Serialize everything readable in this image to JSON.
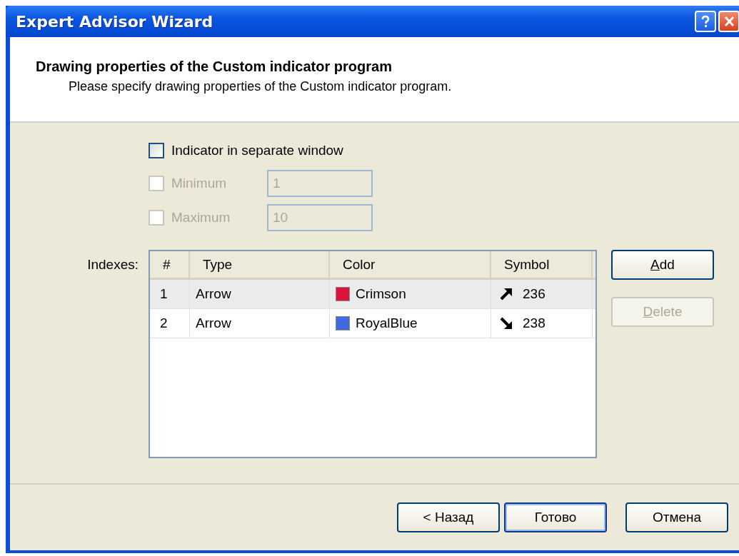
{
  "window": {
    "title": "Expert Advisor Wizard"
  },
  "header": {
    "title": "Drawing properties of the Custom indicator program",
    "subtitle": "Please specify drawing properties of the Custom indicator program."
  },
  "separate_window": {
    "label": "Indicator in separate window",
    "checked": false,
    "disabled": false
  },
  "limits": [
    {
      "label": "Minimum",
      "checked": false,
      "disabled": true,
      "value": "1"
    },
    {
      "label": "Maximum",
      "checked": false,
      "disabled": true,
      "value": "10"
    }
  ],
  "indexes": {
    "label": "Indexes:",
    "columns": [
      "#",
      "Type",
      "Color",
      "Symbol"
    ],
    "rows": [
      {
        "index": "1",
        "type": "Arrow",
        "color_name": "Crimson",
        "color": "#dc143c",
        "symbol": "236",
        "kind": "up",
        "selected": true
      },
      {
        "index": "2",
        "type": "Arrow",
        "color_name": "RoyalBlue",
        "color": "#4169e1",
        "symbol": "238",
        "kind": "down",
        "selected": false
      }
    ]
  },
  "side_buttons": [
    {
      "label": "Add",
      "disabled": false
    },
    {
      "label": "Delete",
      "disabled": true
    }
  ],
  "footer_buttons": [
    {
      "label": "< Назад",
      "default": false
    },
    {
      "label": "Готово",
      "default": true
    },
    {
      "label": "Отмена",
      "default": false
    }
  ]
}
